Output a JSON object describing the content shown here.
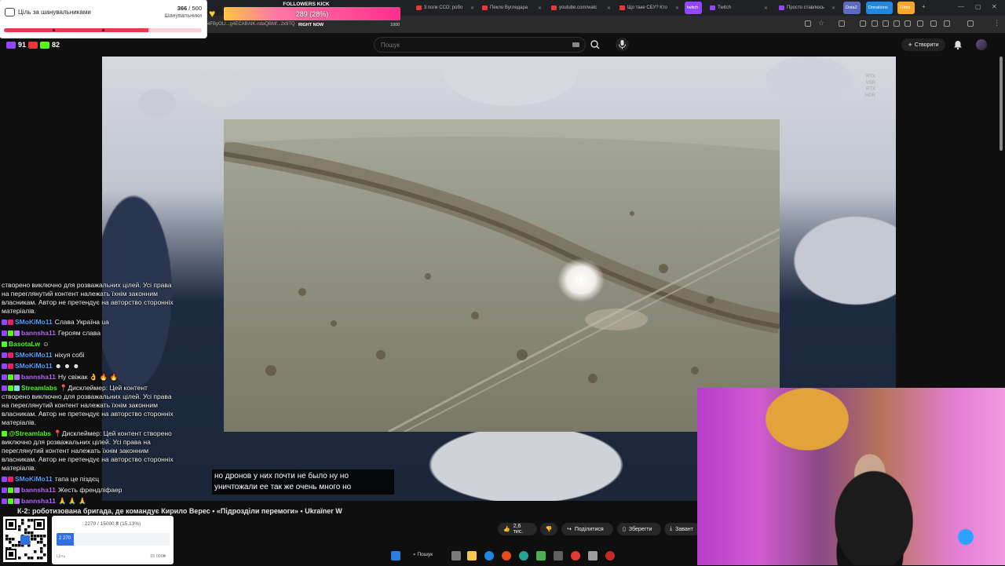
{
  "browser": {
    "tabs": [
      {
        "label": "3 полк ССО: робо",
        "color": "#e53935"
      },
      {
        "label": "Пекло Вугледара",
        "color": "#e53935"
      },
      {
        "label": "youtube.com/watc",
        "color": "#e53935"
      },
      {
        "label": "Що таке СБУ? Кто",
        "color": "#e53935"
      },
      {
        "label": "twitch",
        "color": "#9146ff"
      },
      {
        "label": "Twitch",
        "color": "#9146ff"
      },
      {
        "label": "Просто ставлюсь",
        "color": "#9146ff"
      },
      {
        "label": "Dota2",
        "color": "#5c6bc0"
      },
      {
        "label": "Donations",
        "color": "#1e88e5"
      },
      {
        "label": "Films",
        "color": "#f9a825"
      }
    ],
    "address_fragment": "4FByOLI...g4ECABAIK-ndaQBMf...2x9TQ",
    "new_tab": "+",
    "controls": {
      "min": "—",
      "max": "▢",
      "close": "✕"
    }
  },
  "youtube": {
    "search_placeholder": "Пошук",
    "create_label": "Створити",
    "video_title": "К-2: роботизована бригада, де командує Кирило Верес • «Підрозділи перемоги» • Ukraïner W",
    "actions": {
      "likes": "2,6 тис.",
      "share": "Поділитися",
      "save": "Зберегти",
      "download": "Завант"
    },
    "subtitle_line1": "но дронов у них почти не было ну но",
    "subtitle_line2": "уничтожали ее так же очень много но",
    "rtx_label_1": "RTX",
    "rtx_label_2": "VSR",
    "rtx_label_3": "RTX",
    "rtx_label_4": "HDR"
  },
  "overlays": {
    "goal": {
      "title": "Ціль за шанувальниками",
      "current": "366",
      "target": "500",
      "subtitle": "Шанувальники",
      "progress": 0.732
    },
    "followers_kick": {
      "title": "FOLLOWERS KICK",
      "value_label": "289 (28%)",
      "min": "0",
      "max": "1000",
      "right_now": "RIGHT NOW",
      "progress": 0.28
    },
    "viewers": {
      "youtube": "91",
      "kick": "82"
    },
    "donation": {
      "label": "2270 / 15000 ₴ (15.13%)",
      "bar_value": "2 270",
      "min": "Ціль",
      "max": "15 000₴",
      "progress": 0.1513
    }
  },
  "chat": [
    {
      "user": "",
      "color": "#ffffff",
      "text": "створено виключно для розважальних цілей. Усі права на переглянутий контент належать їхнім законним власникам. Автор не претендує на авторство сторонніх матеріалів.",
      "badges": []
    },
    {
      "user": "SMoKiMo11",
      "color": "#4fa3ff",
      "text": "Слава Україна ua",
      "badges": [
        "#9146ff",
        "#e91e63"
      ]
    },
    {
      "user": "bannsha11",
      "color": "#b86bff",
      "text": "Героям слава",
      "badges": [
        "#9146ff",
        "#53fc18",
        "#b86bff"
      ]
    },
    {
      "user": "BasotaLw",
      "color": "#53fc18",
      "text": "☺",
      "badges": [
        "#53fc18"
      ]
    },
    {
      "user": "SMoKiMo11",
      "color": "#4fa3ff",
      "text": "ніхуя собі",
      "badges": [
        "#9146ff",
        "#e91e63"
      ]
    },
    {
      "user": "SMoKiMo11",
      "color": "#4fa3ff",
      "text": "☻ ☻ ☻",
      "badges": [
        "#9146ff",
        "#e91e63"
      ]
    },
    {
      "user": "bannsha11",
      "color": "#b86bff",
      "text": "Ну свіжак 👌 🔥 🔥",
      "badges": [
        "#9146ff",
        "#53fc18",
        "#b86bff"
      ]
    },
    {
      "user": "Streamlabs",
      "color": "#53fc18",
      "text": "📍Дисклеймер: Цей контент створено виключно для розважальних цілей. Усі права на переглянутий контент належать їхнім законним власникам. Автор не претендує на авторство сторонніх матеріалів.",
      "badges": [
        "#9146ff",
        "#53fc18",
        "#80deea"
      ]
    },
    {
      "user": "@Streamlabs",
      "color": "#53fc18",
      "text": "📍Дисклеймер: Цей контент створено виключно для розважальних цілей. Усі права на переглянутий контент належать їхнім законним власникам. Автор не претендує на авторство сторонніх матеріалів.",
      "badges": [
        "#53fc18"
      ]
    },
    {
      "user": "SMoKiMo11",
      "color": "#4fa3ff",
      "text": "тапа це піздєц",
      "badges": [
        "#9146ff",
        "#e91e63"
      ]
    },
    {
      "user": "bannsha11",
      "color": "#b86bff",
      "text": "Жесть френдліфаер",
      "badges": [
        "#9146ff",
        "#53fc18",
        "#b86bff"
      ]
    },
    {
      "user": "bannsha11",
      "color": "#b86bff",
      "text": "🙏 🙏 🙏",
      "badges": [
        "#9146ff",
        "#53fc18",
        "#b86bff"
      ]
    }
  ],
  "taskbar": {
    "search_label": "Пошук"
  },
  "colors": {
    "accent_red": "#e53950",
    "kick_green": "#53fc18",
    "twitch_purple": "#9146ff"
  }
}
